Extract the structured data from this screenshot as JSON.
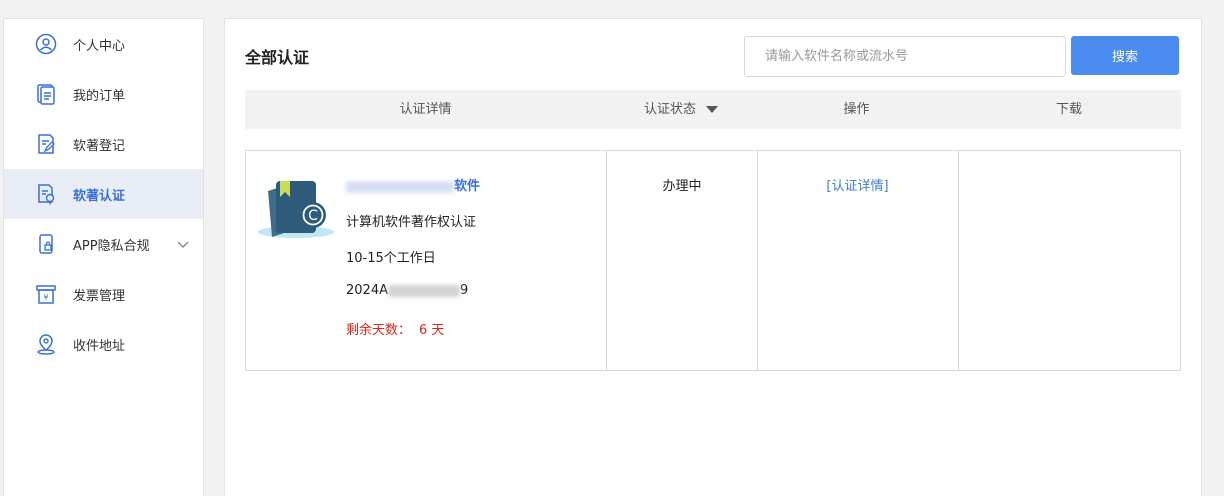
{
  "sidebar": {
    "items": [
      {
        "label": "个人中心",
        "icon": "user-circle-icon",
        "active": false
      },
      {
        "label": "我的订单",
        "icon": "order-icon",
        "active": false
      },
      {
        "label": "软著登记",
        "icon": "register-icon",
        "active": false
      },
      {
        "label": "软著认证",
        "icon": "certify-icon",
        "active": true
      },
      {
        "label": "APP隐私合规",
        "icon": "phone-lock-icon",
        "active": false,
        "expandable": true
      },
      {
        "label": "发票管理",
        "icon": "invoice-icon",
        "active": false
      },
      {
        "label": "收件地址",
        "icon": "location-icon",
        "active": false
      }
    ]
  },
  "main": {
    "title": "全部认证",
    "search": {
      "placeholder": "请输入软件名称或流水号",
      "value": "",
      "button_label": "搜索"
    },
    "table": {
      "headers": [
        "认证详情",
        "认证状态",
        "操作",
        "下载"
      ],
      "rows": [
        {
          "name_visible": "软件",
          "type": "计算机软件著作权认证",
          "duration": "10-15个工作日",
          "serial_prefix": "2024A",
          "serial_suffix": "9",
          "remaining_label": "剩余天数：",
          "remaining_value": "6 天",
          "status": "办理中",
          "action": "[认证详情]",
          "download": ""
        }
      ]
    }
  },
  "colors": {
    "accent": "#3a6fd8",
    "button": "#4a8cf0",
    "alert": "#d4281c"
  }
}
